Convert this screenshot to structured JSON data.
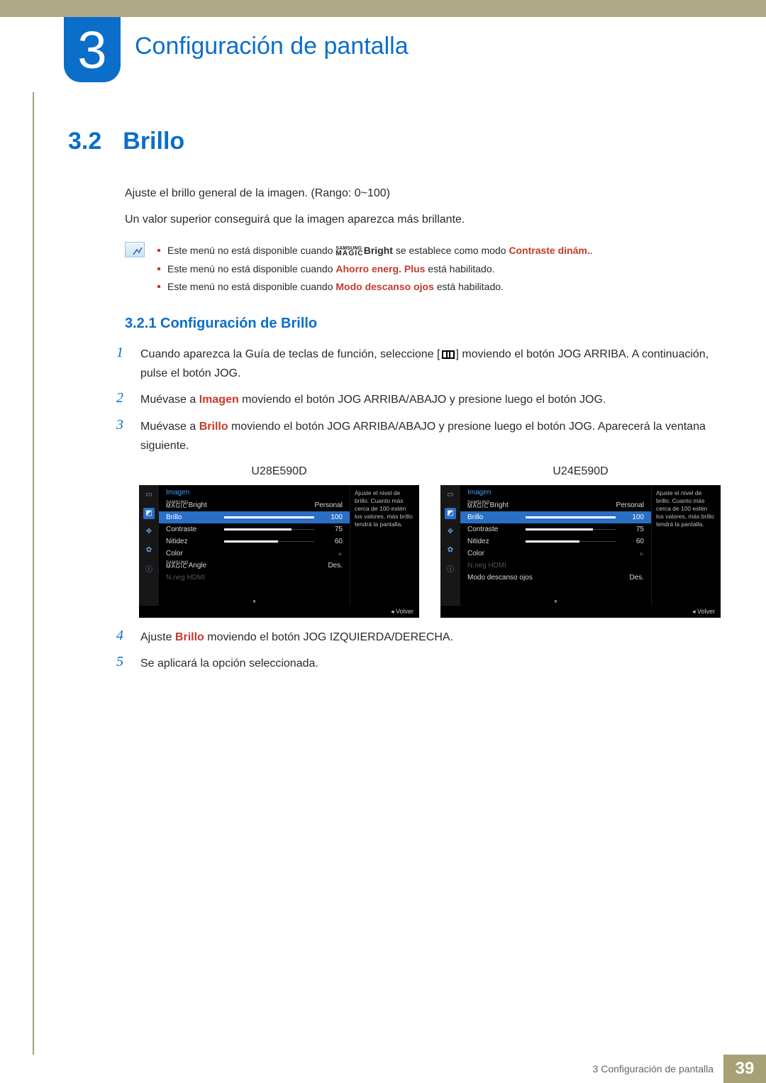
{
  "chapter": {
    "number": "3",
    "title": "Configuración de pantalla"
  },
  "section": {
    "number": "3.2",
    "title": "Brillo"
  },
  "intro": {
    "line1": "Ajuste el brillo general de la imagen. (Rango: 0~100)",
    "line2": "Un valor superior conseguirá que la imagen aparezca más brillante."
  },
  "notes": {
    "n1a": "Este menú no está disponible cuando ",
    "n1b": "Bright",
    "n1c": " se establece como modo ",
    "n1d": "Contraste dinám.",
    "n1e": ".",
    "n2a": "Este menú no está disponible cuando ",
    "n2b": "Ahorro energ. Plus",
    "n2c": " está habilitado.",
    "n3a": "Este menú no está disponible cuando ",
    "n3b": "Modo descanso ojos",
    "n3c": " está habilitado."
  },
  "subsection": {
    "number_title": "3.2.1   Configuración de Brillo"
  },
  "steps": {
    "s1a": "Cuando aparezca la Guía de teclas de función, seleccione [",
    "s1b": "] moviendo el botón JOG ARRIBA. A continuación, pulse el botón JOG.",
    "s2a": "Muévase a ",
    "s2b": "Imagen",
    "s2c": " moviendo el botón JOG ARRIBA/ABAJO y presione luego el botón JOG.",
    "s3a": "Muévase a ",
    "s3b": "Brillo",
    "s3c": " moviendo el botón JOG ARRIBA/ABAJO y presione luego el botón JOG. Aparecerá la ventana siguiente.",
    "s4a": "Ajuste ",
    "s4b": "Brillo",
    "s4c": " moviendo el botón JOG IZQUIERDA/DERECHA.",
    "s5": "Se aplicará la opción seleccionada."
  },
  "magic": {
    "top": "SAMSUNG",
    "bot": "MAGIC"
  },
  "osd_models": {
    "left": "U28E590D",
    "right": "U24E590D"
  },
  "osd_common": {
    "header": "Imagen",
    "help": "Ajuste el nivel de brillo. Cuanto más cerca de 100 estén los valores, más brillo tendrá la pantalla.",
    "return": "Volver",
    "magic_bright": "Bright",
    "personal": "Personal",
    "brillo": "Brillo",
    "contraste": "Contraste",
    "nitidez": "Nitidez",
    "color": "Color",
    "des": "Des.",
    "val100": "100",
    "val75": "75",
    "val60": "60"
  },
  "osd_left_extra": {
    "magic_angle": "Angle",
    "neg_hdmi": "N.neg HDMI"
  },
  "osd_right_extra": {
    "neg_hdmi": "N.neg HDMI",
    "eye_saver": "Modo descanso ojos"
  },
  "footer": {
    "text": "3 Configuración de pantalla",
    "page": "39"
  }
}
